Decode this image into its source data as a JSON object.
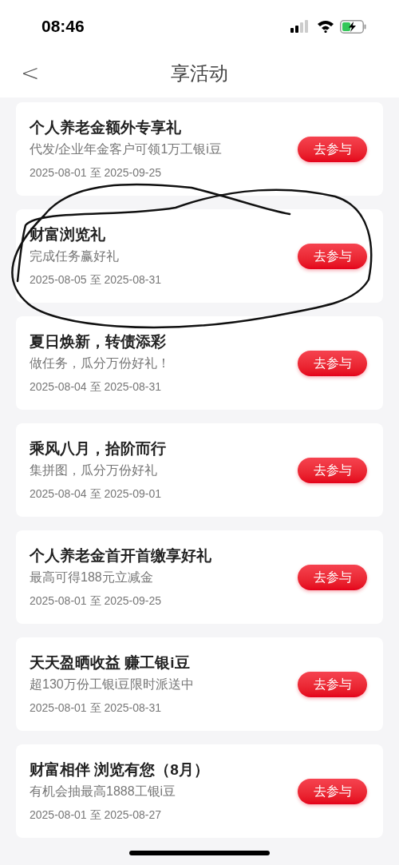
{
  "status_bar": {
    "time": "08:46"
  },
  "header": {
    "back": "<",
    "title": "享活动"
  },
  "activities": [
    {
      "title": "个人养老金额外专享礼",
      "description": "代发/企业年金客户可领1万工银i豆",
      "dates": "2025-08-01 至 2025-09-25",
      "button": "去参与"
    },
    {
      "title": "财富浏览礼",
      "description": "完成任务赢好礼",
      "dates": "2025-08-05 至 2025-08-31",
      "button": "去参与"
    },
    {
      "title": "夏日焕新，转债添彩",
      "description": "做任务，瓜分万份好礼！",
      "dates": "2025-08-04 至 2025-08-31",
      "button": "去参与"
    },
    {
      "title": "乘风八月，拾阶而行",
      "description": "集拼图，瓜分万份好礼",
      "dates": "2025-08-04 至 2025-09-01",
      "button": "去参与"
    },
    {
      "title": "个人养老金首开首缴享好礼",
      "description": "最高可得188元立减金",
      "dates": "2025-08-01 至 2025-09-25",
      "button": "去参与"
    },
    {
      "title": "天天盈晒收益 赚工银i豆",
      "description": "超130万份工银i豆限时派送中",
      "dates": "2025-08-01 至 2025-08-31",
      "button": "去参与"
    },
    {
      "title": "财富相伴 浏览有您（8月）",
      "description": "有机会抽最高1888工银i豆",
      "dates": "2025-08-01 至 2025-08-27",
      "button": "去参与"
    }
  ]
}
